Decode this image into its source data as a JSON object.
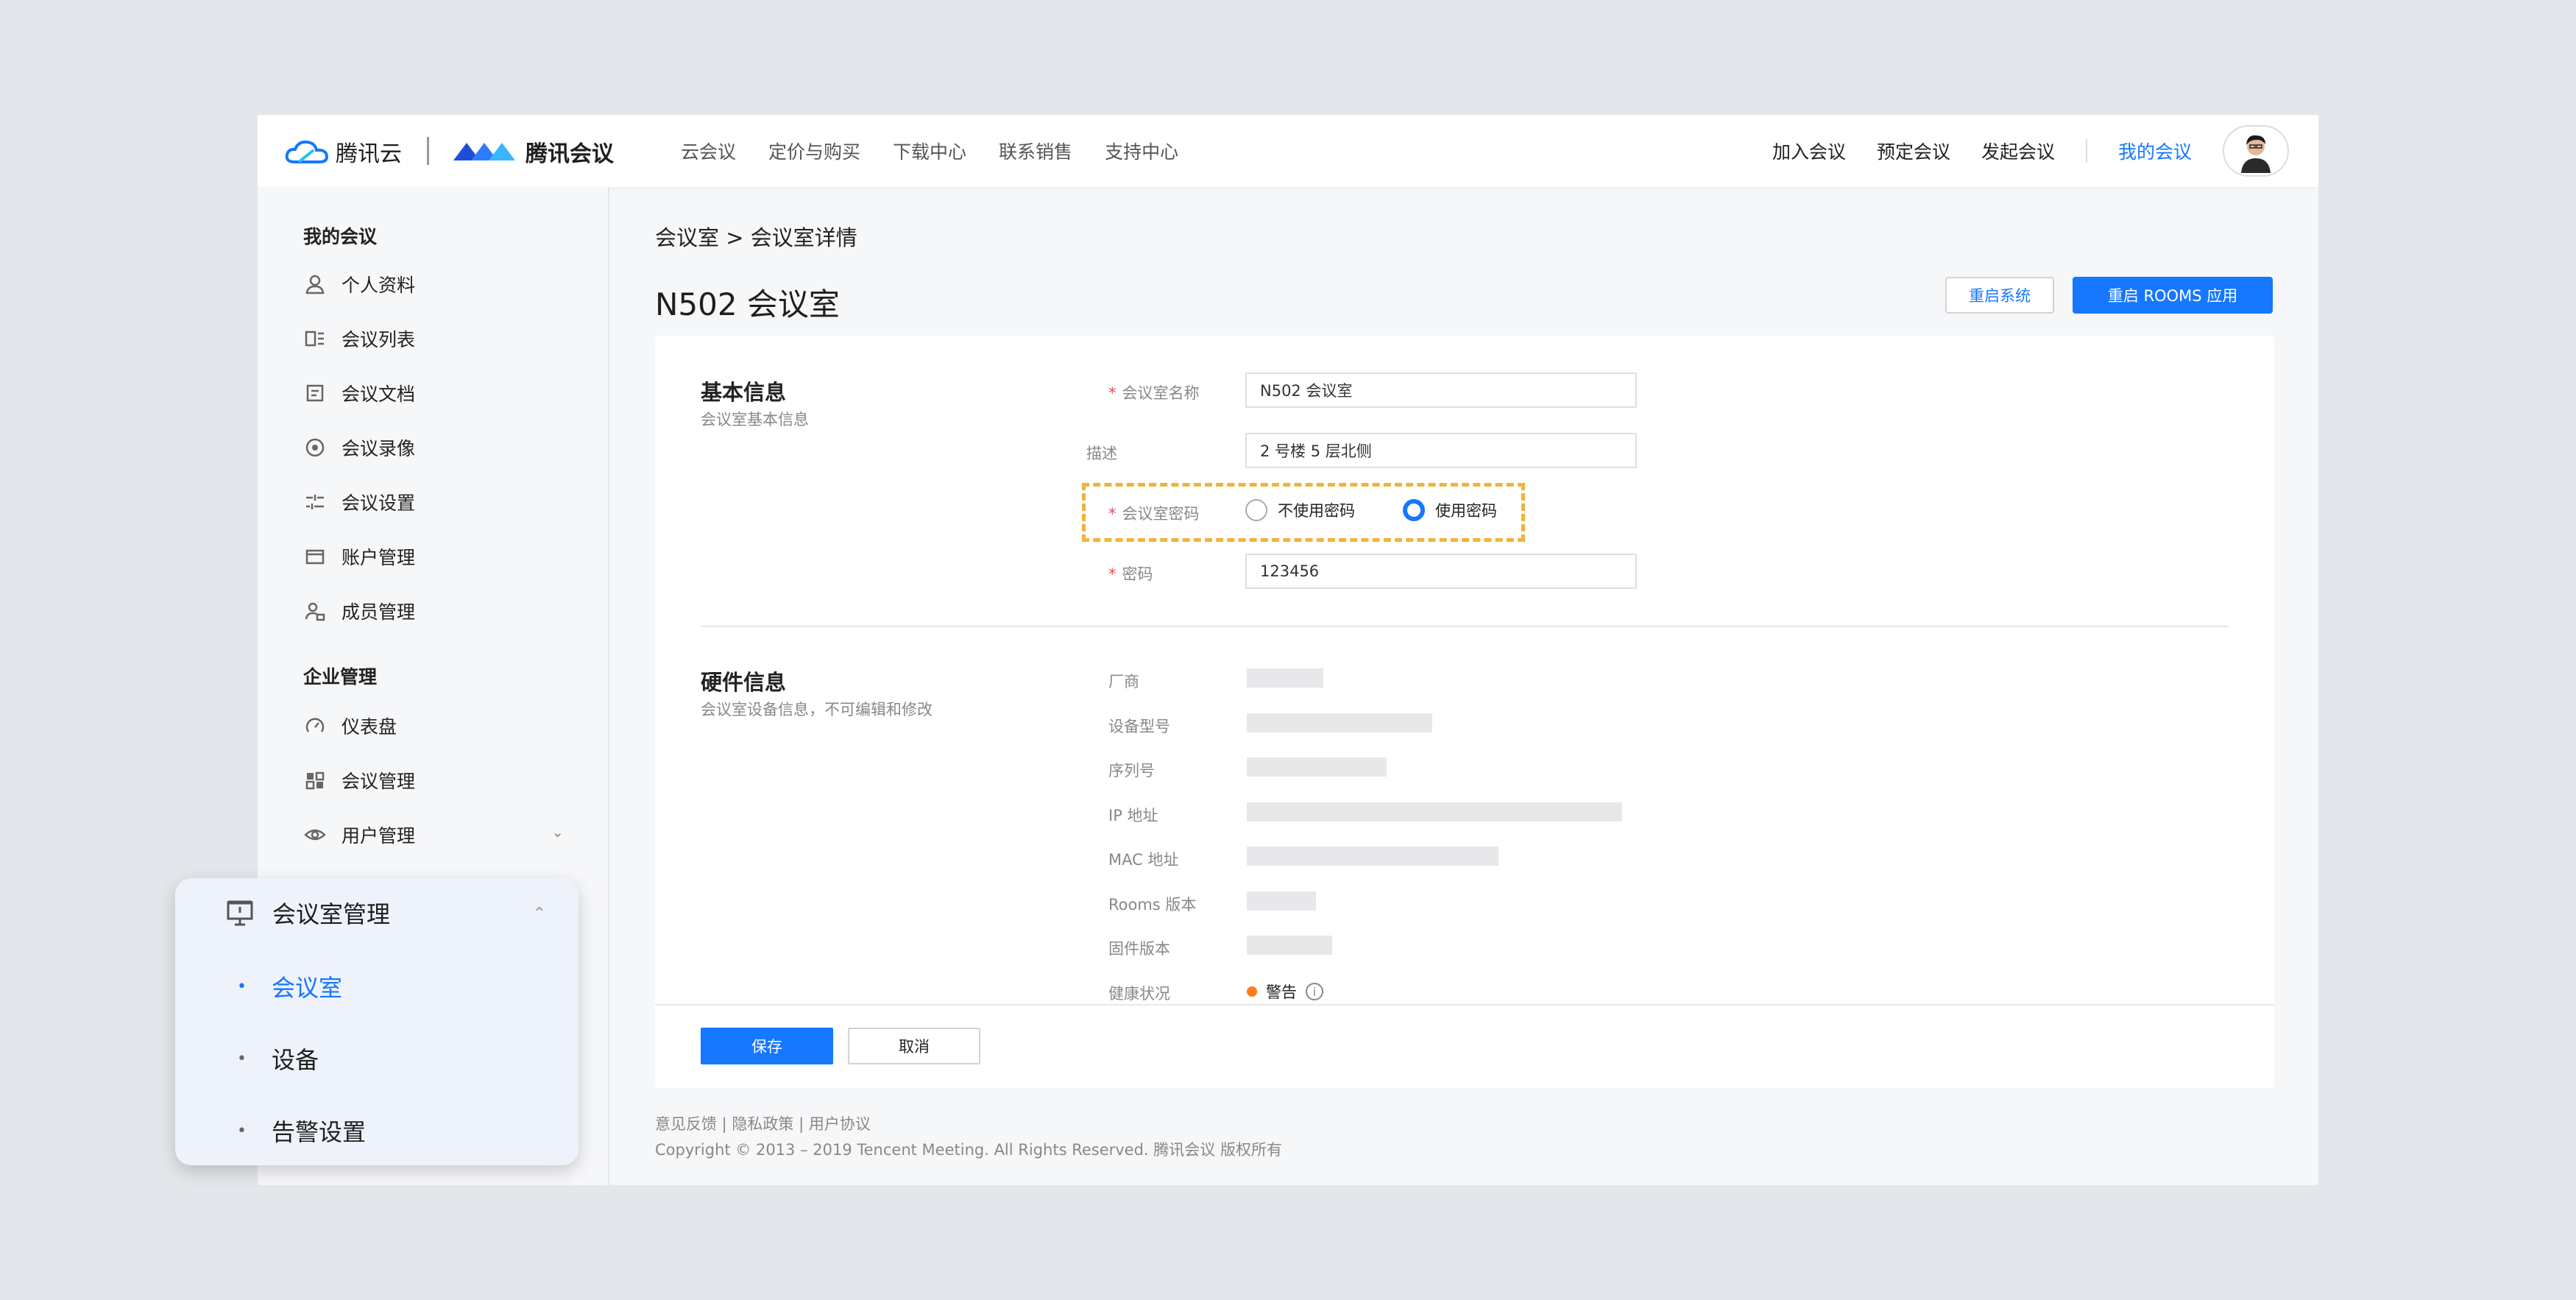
{
  "header": {
    "brand1": "腾讯云",
    "brand2": "腾讯会议",
    "nav": [
      "云会议",
      "定价与购买",
      "下载中心",
      "联系销售",
      "支持中心"
    ],
    "actions": [
      "加入会议",
      "预定会议",
      "发起会议"
    ],
    "my_meetings": "我的会议"
  },
  "sidebar": {
    "section1": "我的会议",
    "items1": [
      {
        "label": "个人资料",
        "icon": "user-icon"
      },
      {
        "label": "会议列表",
        "icon": "list-icon"
      },
      {
        "label": "会议文档",
        "icon": "document-icon"
      },
      {
        "label": "会议录像",
        "icon": "record-icon"
      },
      {
        "label": "会议设置",
        "icon": "settings-sliders-icon"
      },
      {
        "label": "账户管理",
        "icon": "wallet-icon"
      },
      {
        "label": "成员管理",
        "icon": "members-icon"
      }
    ],
    "section2": "企业管理",
    "items2": [
      {
        "label": "仪表盘",
        "icon": "dashboard-icon"
      },
      {
        "label": "会议管理",
        "icon": "grid-icon"
      },
      {
        "label": "用户管理",
        "icon": "eye-icon"
      }
    ],
    "submenu": {
      "title": "会议室管理",
      "items": [
        "会议室",
        "设备",
        "告警设置"
      ],
      "active": "会议室"
    }
  },
  "main": {
    "breadcrumb": "会议室 > 会议室详情",
    "title": "N502 会议室",
    "restart_system": "重启系统",
    "restart_app": "重启 ROOMS 应用",
    "basic": {
      "title": "基本信息",
      "subtitle": "会议室基本信息",
      "name_label": "会议室名称",
      "name_value": "N502 会议室",
      "desc_label": "描述",
      "desc_value": "2 号楼 5 层北侧",
      "pwd_mode_label": "会议室密码",
      "opt_no_pwd": "不使用密码",
      "opt_use_pwd": "使用密码",
      "selected": "使用密码",
      "pwd_label": "密码",
      "pwd_value": "123456"
    },
    "hardware": {
      "title": "硬件信息",
      "subtitle": "会议室设备信息，不可编辑和修改",
      "fields": [
        "厂商",
        "设备型号",
        "序列号",
        "IP 地址",
        "MAC 地址",
        "Rooms 版本",
        "固件版本",
        "健康状况"
      ],
      "health_status": "警告"
    },
    "save": "保存",
    "cancel": "取消",
    "footer_links": "意见反馈 | 隐私政策 | 用户协议",
    "copyright": "Copyright © 2013 – 2019 Tencent Meeting. All Rights Reserved.  腾讯会议 版权所有"
  },
  "colors": {
    "accent": "#1677ff",
    "highlight": "#f0b43c",
    "warning": "#ff7a1a"
  }
}
